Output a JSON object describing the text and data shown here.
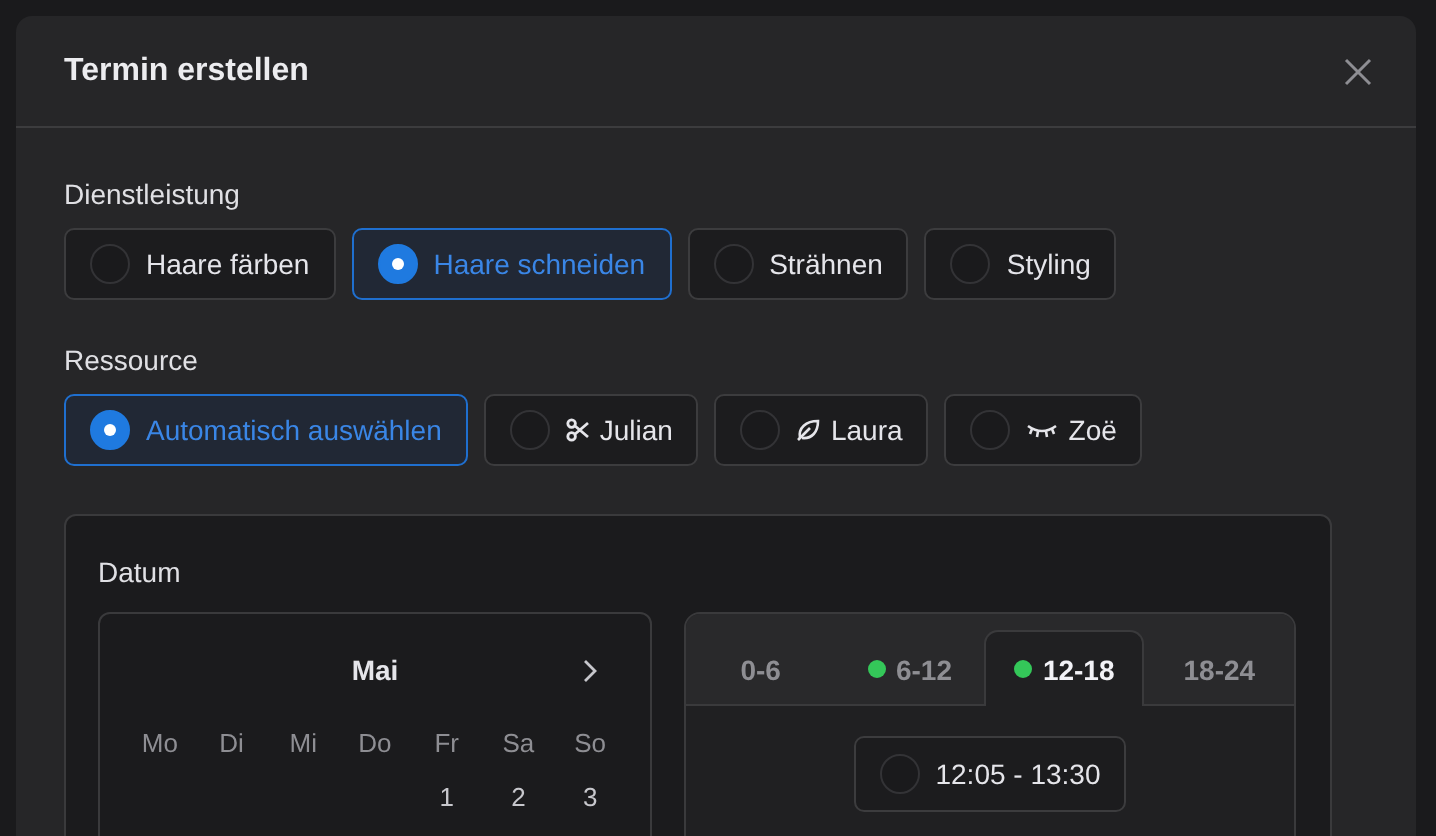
{
  "dialog": {
    "title": "Termin erstellen"
  },
  "service": {
    "label": "Dienstleistung",
    "options": [
      {
        "label": "Haare färben",
        "selected": false
      },
      {
        "label": "Haare schneiden",
        "selected": true
      },
      {
        "label": "Strähnen",
        "selected": false
      },
      {
        "label": "Styling",
        "selected": false
      }
    ]
  },
  "resource": {
    "label": "Ressource",
    "options": [
      {
        "label": "Automatisch auswählen",
        "kind": "auto",
        "selected": true
      },
      {
        "label": "Julian",
        "kind": "scissors",
        "selected": false
      },
      {
        "label": "Laura",
        "kind": "leaf",
        "selected": false
      },
      {
        "label": "Zoë",
        "kind": "eye",
        "selected": false
      }
    ]
  },
  "date": {
    "label": "Datum",
    "calendar": {
      "month": "Mai",
      "columns": [
        {
          "weekday": "Mo"
        },
        {
          "weekday": "Di"
        },
        {
          "weekday": "Mi"
        },
        {
          "weekday": "Do"
        },
        {
          "weekday": "Fr",
          "days": [
            "1"
          ]
        },
        {
          "weekday": "Sa",
          "days": [
            "2"
          ]
        },
        {
          "weekday": "So",
          "days": [
            "3"
          ]
        }
      ]
    },
    "time_tabs": [
      {
        "label": "0-6",
        "available": false,
        "selected": false
      },
      {
        "label": "6-12",
        "available": true,
        "selected": false
      },
      {
        "label": "12-18",
        "available": true,
        "selected": true
      },
      {
        "label": "18-24",
        "available": false,
        "selected": false
      }
    ],
    "slots": [
      {
        "label": "12:05 - 13:30",
        "selected": false
      }
    ]
  }
}
